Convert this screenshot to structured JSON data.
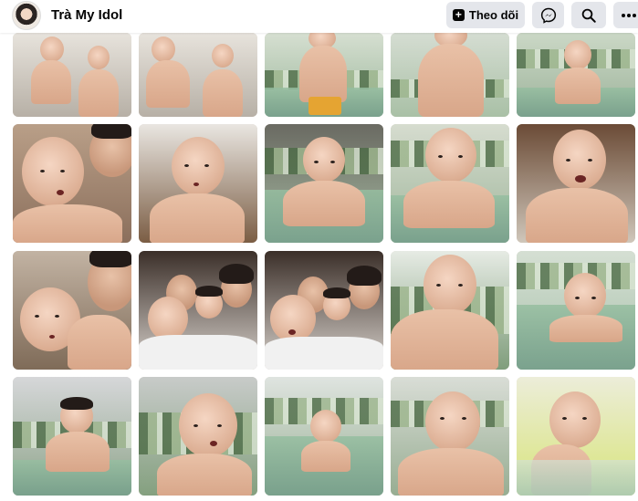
{
  "header": {
    "page_name": "Trà My Idol",
    "follow_label": "Theo dõi",
    "icons": {
      "avatar": "profile-avatar",
      "follow": "plus-square-icon",
      "message": "messenger-icon",
      "search": "search-icon",
      "more": "ellipsis-icon"
    }
  },
  "grid": {
    "rows": 4,
    "columns": 5,
    "photos": [
      {
        "scene": "two-boys-sofa"
      },
      {
        "scene": "two-boys-sofa"
      },
      {
        "scene": "pool-toy-boy"
      },
      {
        "scene": "pool-boy-closeup"
      },
      {
        "scene": "baby-pool"
      },
      {
        "scene": "selfie-mom-baby"
      },
      {
        "scene": "baby-room"
      },
      {
        "scene": "baby-pool"
      },
      {
        "scene": "baby-pool"
      },
      {
        "scene": "baby-crying"
      },
      {
        "scene": "selfie-mom-baby"
      },
      {
        "scene": "family-group"
      },
      {
        "scene": "family-group"
      },
      {
        "scene": "baby-pool-closeup"
      },
      {
        "scene": "baby-pool-floating"
      },
      {
        "scene": "boy-pool"
      },
      {
        "scene": "baby-pool-closeup"
      },
      {
        "scene": "baby-pool-wide"
      },
      {
        "scene": "baby-pool-hands"
      },
      {
        "scene": "baby-pool-side"
      }
    ]
  },
  "colors": {
    "button_bg": "#e4e6eb",
    "text": "#050505",
    "page_bg": "#ffffff"
  }
}
